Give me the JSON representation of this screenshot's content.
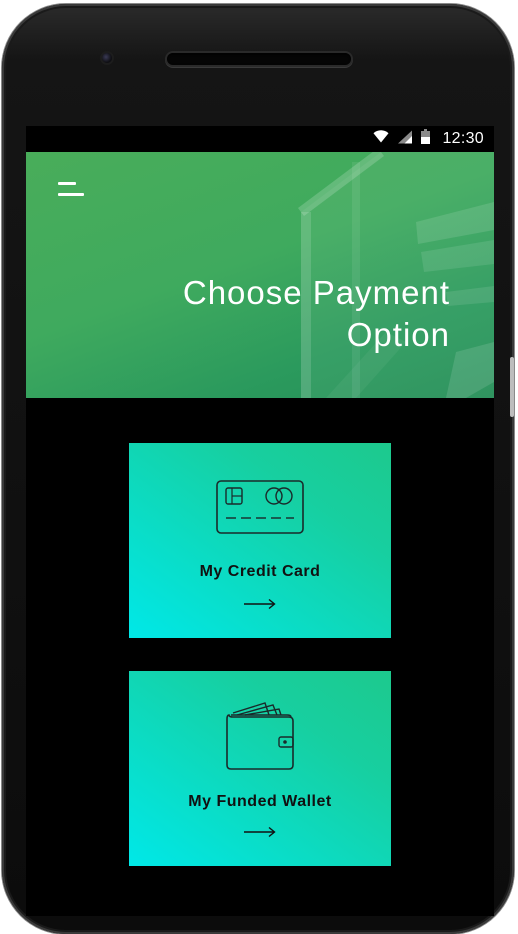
{
  "status_bar": {
    "time": "12:30",
    "icons": [
      "wifi-icon",
      "cell-signal-icon",
      "battery-icon"
    ]
  },
  "header": {
    "title_line1": "Choose Payment",
    "title_line2": "Option",
    "menu_icon": "menu-icon"
  },
  "options": [
    {
      "label": "My Credit Card",
      "icon": "credit-card-icon",
      "arrow": "arrow-right-icon"
    },
    {
      "label": "My Funded Wallet",
      "icon": "wallet-icon",
      "arrow": "arrow-right-icon"
    }
  ],
  "colors": {
    "header_green": "#3faa5e",
    "card_cyan": "#00e8e8",
    "card_green": "#1dc98d",
    "text_dark": "#111111"
  }
}
